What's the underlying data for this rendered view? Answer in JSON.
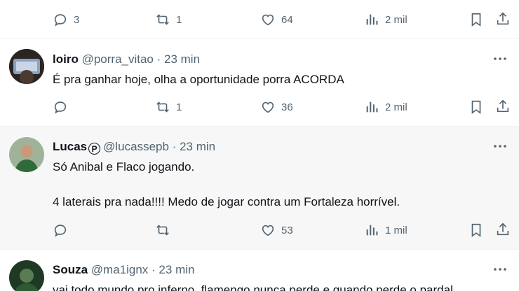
{
  "top_bar": {
    "replies": "3",
    "reposts": "1",
    "likes": "64",
    "views": "2 mil"
  },
  "tweets": [
    {
      "name": "loiro",
      "handle": "@porra_vitao",
      "time": "· 23 min",
      "text": "É pra ganhar hoje, olha a oportunidade porra ACORDA",
      "replies": "",
      "reposts": "1",
      "likes": "36",
      "views": "2 mil"
    },
    {
      "name": "Lucas",
      "badge": "P",
      "handle": "@lucassepb",
      "time": "· 23 min",
      "text_line1": "Só Anibal e Flaco jogando.",
      "text_line2": "4 laterais pra nada!!!! Medo de jogar contra um Fortaleza horrível.",
      "replies": "",
      "reposts": "",
      "likes": "53",
      "views": "1 mil"
    },
    {
      "name": "Souza",
      "handle": "@ma1ignx",
      "time": "· 23 min",
      "text": "vai todo mundo pro inferno, flamengo nunca perde e quando perde o pardal"
    }
  ],
  "icons": [
    "reply-icon",
    "repost-icon",
    "like-icon",
    "views-icon",
    "bookmark-icon",
    "share-icon",
    "more-icon"
  ]
}
